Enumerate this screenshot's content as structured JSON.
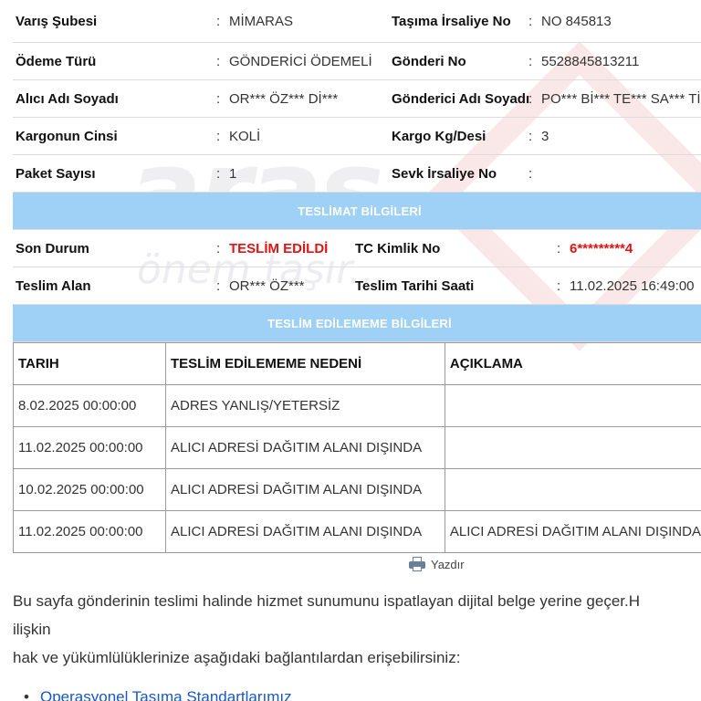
{
  "watermark": {
    "brand": "aras",
    "slogan": "önem taşır..."
  },
  "shipment": {
    "rows": [
      {
        "l1": "Varış Şubesi",
        "v1": "MİMARAS",
        "l2": "Taşıma İrsaliye No",
        "v2": "NO 845813"
      },
      {
        "l1": "Ödeme Türü",
        "v1": "GÖNDERİCİ ÖDEMELİ",
        "l2": "Gönderi No",
        "v2": "5528845813211"
      },
      {
        "l1": "Alıcı Adı Soyadı",
        "v1": "OR*** ÖZ*** Dİ***",
        "l2": "Gönderici Adı Soyadı",
        "v2": "PO*** Bİ*** TE*** SA*** Tİ"
      },
      {
        "l1": "Kargonun Cinsi",
        "v1": "KOLİ",
        "l2": "Kargo Kg/Desi",
        "v2": "3"
      },
      {
        "l1": "Paket Sayısı",
        "v1": "1",
        "l2": "Sevk İrsaliye No",
        "v2": ""
      }
    ]
  },
  "separator": ":",
  "delivery": {
    "title": "TESLİMAT BİLGİLERİ",
    "status_label": "Son Durum",
    "status_value": "TESLİM EDİLDİ",
    "tc_label": "TC Kimlik No",
    "tc_value": "6*********4",
    "receiver_label": "Teslim Alan",
    "receiver_value": "OR*** ÖZ***",
    "datetime_label": "Teslim Tarihi Saati",
    "datetime_value": "11.02.2025 16:49:00"
  },
  "failed": {
    "title": "TESLİM EDİLEMEME BİLGİLERİ",
    "headers": [
      "TARIH",
      "TESLİM EDİLEMEME NEDENİ",
      "AÇIKLAMA"
    ],
    "rows": [
      [
        "8.02.2025 00:00:00",
        "ADRES YANLIŞ/YETERSİZ",
        ""
      ],
      [
        "11.02.2025 00:00:00",
        "ALICI ADRESİ DAĞITIM ALANI DIŞINDA",
        ""
      ],
      [
        "10.02.2025 00:00:00",
        "ALICI ADRESİ DAĞITIM ALANI DIŞINDA",
        ""
      ],
      [
        "11.02.2025 00:00:00",
        "ALICI ADRESİ DAĞITIM ALANI DIŞINDA",
        "ALICI ADRESİ DAĞITIM ALANI DIŞINDA"
      ]
    ]
  },
  "print_label": "Yazdır",
  "notice": {
    "line1": "Bu sayfa gönderinin teslimi halinde hizmet sunumunu ispatlayan dijital belge yerine geçer.H",
    "line2": "ilişkin",
    "line3": "hak ve yükümlülüklerinize aşağıdaki bağlantılardan erişebilirsiniz:"
  },
  "links": [
    "Operasyonel Taşıma Standartlarımız"
  ]
}
